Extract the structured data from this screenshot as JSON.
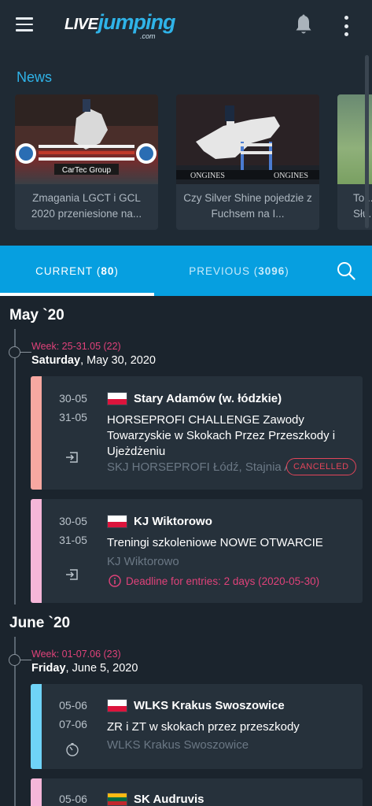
{
  "app": {
    "logo_live": "LIVE",
    "logo_jumping": "jumping",
    "logo_com": ".com"
  },
  "news": {
    "title": "News",
    "items": [
      {
        "caption": "Zmagania LGCT i GCL 2020 przeniesione na..."
      },
      {
        "caption": "Czy Silver Shine pojedzie z Fuchsem na I..."
      },
      {
        "caption": "Tor... Słu..."
      }
    ],
    "image_text_1": "CarTec Group",
    "image_text_2": "ONGINES"
  },
  "tabs": {
    "current_label": "CURRENT",
    "current_count": "80",
    "previous_label": "PREVIOUS",
    "previous_count": "3096"
  },
  "sections": [
    {
      "month": "May `20",
      "week": "Week: 25-31.05 (22)",
      "day": "Saturday",
      "date": ", May 30, 2020",
      "events": [
        {
          "date_from": "30-05",
          "date_to": "31-05",
          "country": "PL",
          "place": "Stary Adamów (w. łódzkie)",
          "name": "HORSEPROFI CHALLENGE Zawody Towarzyskie w Skokach Przez Przeszkody i Ujeżdżeniu",
          "organizer": "SKJ HORSEPROFI Łódź, Stajnia A",
          "status": "CANCELLED",
          "bar_color": "#f7a8a1",
          "icon": "entry-login-icon"
        },
        {
          "date_from": "30-05",
          "date_to": "31-05",
          "country": "PL",
          "place": "KJ Wiktorowo",
          "name": "Treningi szkoleniowe NOWE OTWARCIE",
          "organizer": "KJ Wiktorowo",
          "deadline": "Deadline for entries: 2 days (2020-05-30)",
          "bar_color": "#f5b6d8",
          "icon": "entry-login-icon"
        }
      ]
    },
    {
      "month": "June `20",
      "week": "Week: 01-07.06 (23)",
      "day": "Friday",
      "date": ", June 5, 2020",
      "events": [
        {
          "date_from": "05-06",
          "date_to": "07-06",
          "country": "PL",
          "place": "WLKS Krakus Swoszowice",
          "name": "ZR i ZT w skokach przez przeszkody",
          "organizer": "WLKS Krakus Swoszowice",
          "bar_color": "#6fd3f7",
          "icon": "timer-icon"
        },
        {
          "date_from": "05-06",
          "country": "LT",
          "place": "SK Audruvis",
          "bar_color": "#f5b6d8"
        }
      ]
    }
  ],
  "colors": {
    "accent": "#069fe0",
    "week": "#e0427a",
    "cancel": "#e2455a"
  }
}
